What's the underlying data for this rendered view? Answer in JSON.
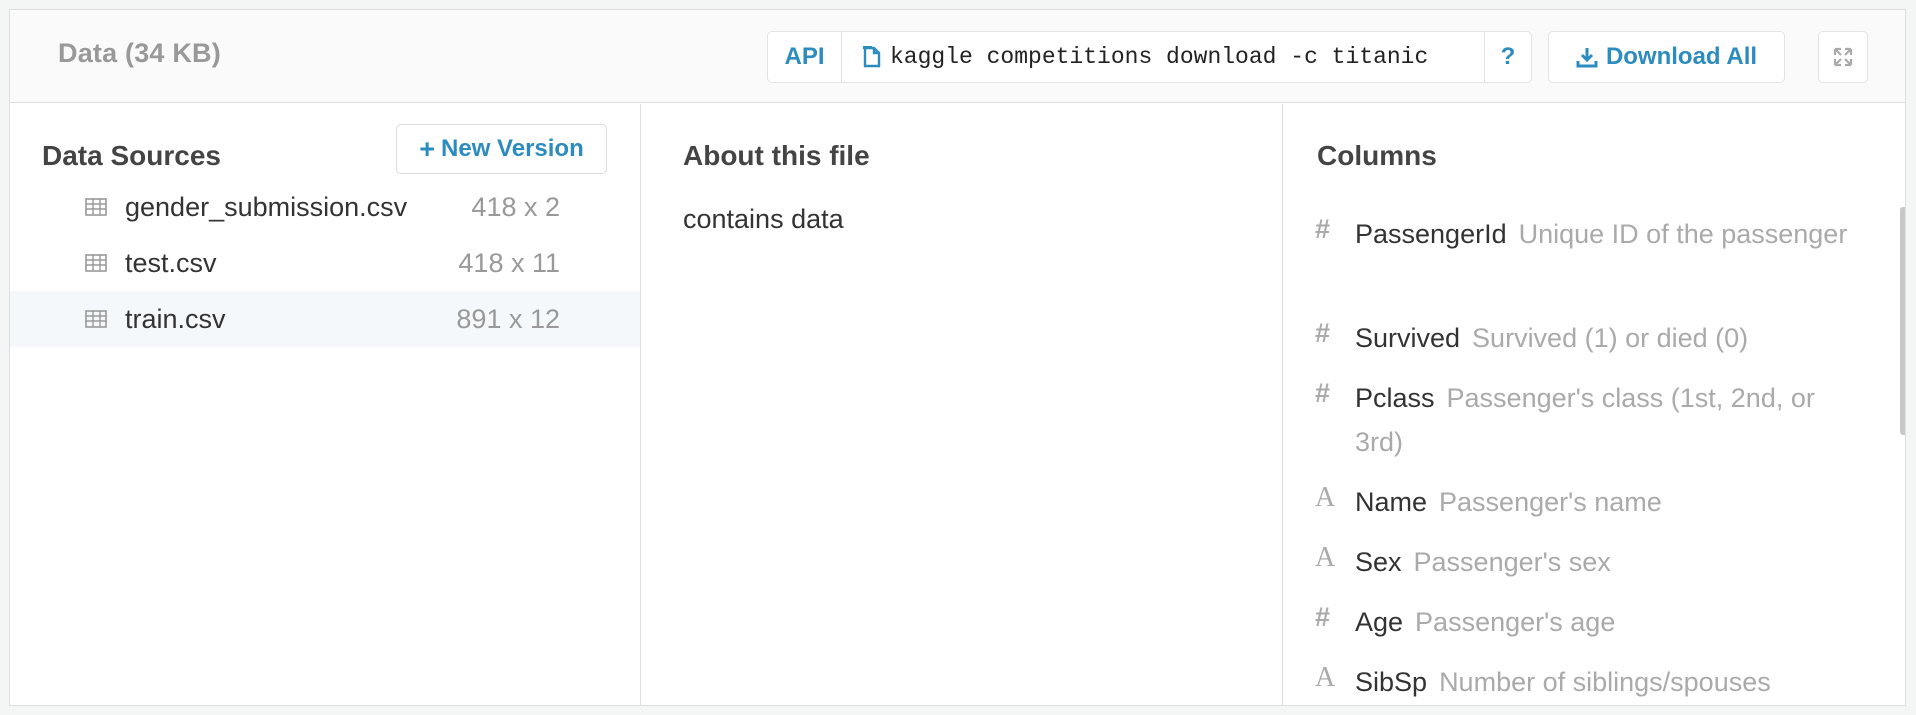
{
  "header": {
    "title": "Data (34 KB)",
    "api_label": "API",
    "api_command": "kaggle competitions download -c titanic",
    "help_label": "?",
    "download_label": "Download All"
  },
  "sources": {
    "title": "Data Sources",
    "new_version_label": "New Version",
    "files": [
      {
        "name": "gender_submission.csv",
        "size": "418 x 2"
      },
      {
        "name": "test.csv",
        "size": "418 x 11"
      },
      {
        "name": "train.csv",
        "size": "891 x 12"
      }
    ]
  },
  "about": {
    "title": "About this file",
    "text": "contains data"
  },
  "columns": {
    "title": "Columns",
    "items": [
      {
        "icon": "#",
        "name": "PassengerId",
        "desc": "Unique ID of the passenger"
      },
      {
        "icon": "#",
        "name": "Survived",
        "desc": "Survived (1) or died (0)"
      },
      {
        "icon": "#",
        "name": "Pclass",
        "desc": "Passenger's class (1st, 2nd, or 3rd)"
      },
      {
        "icon": "A",
        "name": "Name",
        "desc": "Passenger's name"
      },
      {
        "icon": "A",
        "name": "Sex",
        "desc": "Passenger's sex"
      },
      {
        "icon": "#",
        "name": "Age",
        "desc": "Passenger's age"
      },
      {
        "icon": "A",
        "name": "SibSp",
        "desc": "Number of siblings/spouses"
      }
    ]
  },
  "colors": {
    "accent": "#2d8cbf",
    "muted": "#999999",
    "selected_row": "#f4f8fb"
  }
}
